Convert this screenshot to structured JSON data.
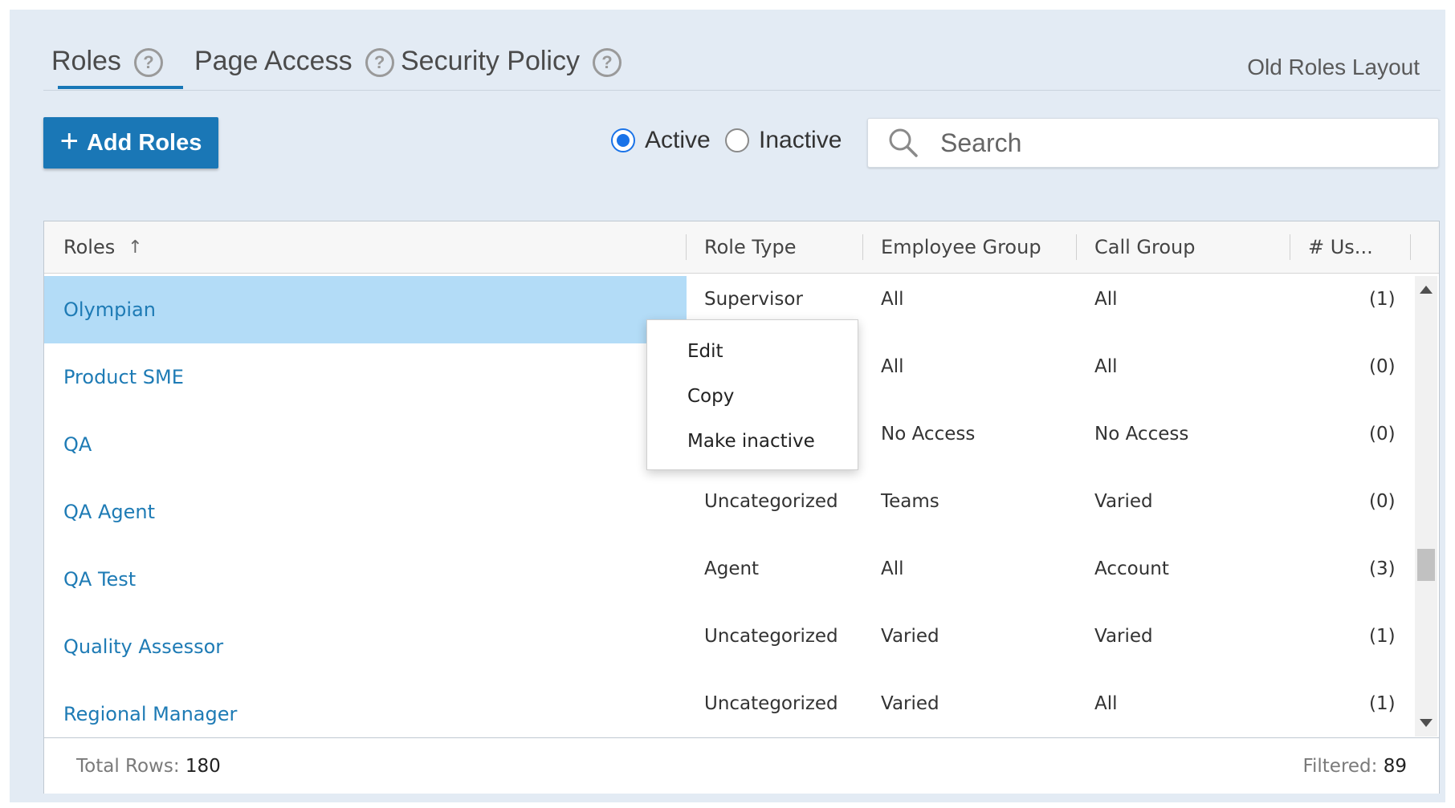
{
  "tabs": [
    {
      "label": "Roles",
      "active": true
    },
    {
      "label": "Page Access",
      "active": false
    },
    {
      "label": "Security Policy",
      "active": false
    }
  ],
  "help_glyph": "?",
  "old_layout_link": "Old Roles Layout",
  "toolbar": {
    "add_label": "Add Roles",
    "plus_glyph": "+",
    "radio_active": "Active",
    "radio_inactive": "Inactive",
    "selected_status": "Active",
    "search_placeholder": "Search",
    "search_value": ""
  },
  "table": {
    "columns": [
      "Roles",
      "Role Type",
      "Employee Group",
      "Call Group",
      "# Us..."
    ],
    "sort_glyph": "↑",
    "rows": [
      {
        "name": "Olympian",
        "role_type": "Supervisor",
        "employee_group": "All",
        "call_group": "All",
        "users": "(1)"
      },
      {
        "name": "Product SME",
        "role_type": "",
        "employee_group": "All",
        "call_group": "All",
        "users": "(0)"
      },
      {
        "name": "QA",
        "role_type": "",
        "employee_group": "No Access",
        "call_group": "No Access",
        "users": "(0)"
      },
      {
        "name": "QA Agent",
        "role_type": "Uncategorized",
        "employee_group": "Teams",
        "call_group": "Varied",
        "users": "(0)"
      },
      {
        "name": "QA Test",
        "role_type": "Agent",
        "employee_group": "All",
        "call_group": "Account",
        "users": "(3)"
      },
      {
        "name": "Quality Assessor",
        "role_type": "Uncategorized",
        "employee_group": "Varied",
        "call_group": "Varied",
        "users": "(1)"
      },
      {
        "name": "Regional Manager",
        "role_type": "Uncategorized",
        "employee_group": "Varied",
        "call_group": "All",
        "users": "(1)"
      }
    ],
    "selected_row": "Olympian",
    "footer": {
      "total_label": "Total Rows:",
      "total_value": "180",
      "filtered_label": "Filtered:",
      "filtered_value": "89"
    }
  },
  "context_menu": {
    "items": [
      "Edit",
      "Copy",
      "Make inactive"
    ]
  },
  "colors": {
    "accent": "#1a77b6",
    "link": "#1e7bb5",
    "selected_row": "#b3dcf7",
    "panel_background": "#e3ebf4"
  },
  "icons": [
    "help-icon",
    "plus-icon",
    "search-icon",
    "sort-ascending-icon",
    "scroll-up-icon",
    "scroll-down-icon"
  ]
}
